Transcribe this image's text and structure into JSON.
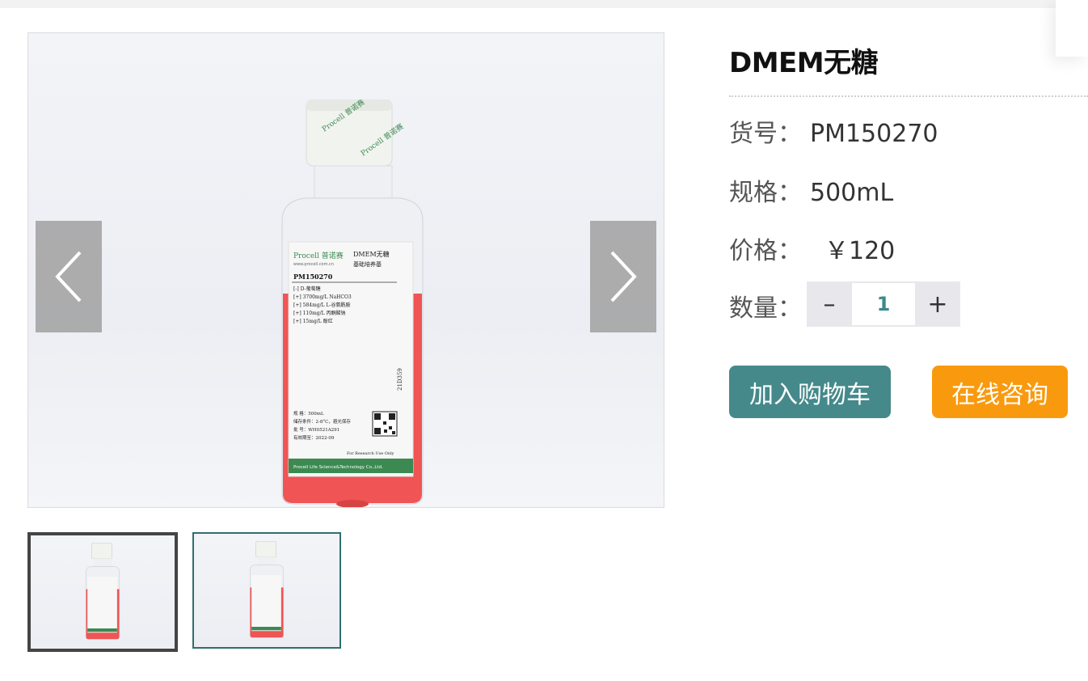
{
  "product": {
    "title": "DMEM无糖",
    "sku_label": "货号：",
    "sku_value": "PM150270",
    "spec_label": "规格：",
    "spec_value": "500mL",
    "price_label": "价格：",
    "price_value": "￥120",
    "qty_label": "数量：",
    "qty_value": "1",
    "minus_label": "–",
    "plus_label": "+"
  },
  "actions": {
    "add_to_cart": "加入购物车",
    "consult": "在线咨询"
  },
  "bottle_label": {
    "brand": "Procell 普诺赛",
    "website": "www.procell.com.cn",
    "product_name": "DMEM无糖",
    "product_sub": "基础培养基",
    "code": "PM150270",
    "ingredients": [
      "[-] D-葡萄糖",
      "[+] 3700mg/L NaHCO3",
      "[+] 584mg/L L-谷氨酰胺",
      "[+] 110mg/L 丙酮酸钠",
      "[+] 15mg/L 酚红"
    ],
    "spec_line": "规    格：500mL",
    "storage_line": "储存条件：2-8°C，避光保存",
    "lot_line": "批    号：WH0521A291",
    "expiry_line": "有效期至：2022-09",
    "side_code": "21D359",
    "research": "For Research Use Only",
    "footer": "Procell Life Science&Technology Co.,Ltd."
  },
  "colors": {
    "accent_teal": "#45898b",
    "accent_orange": "#f99a0e",
    "medium_red": "#f05454"
  },
  "icons": {
    "prev": "chevron-left-icon",
    "next": "chevron-right-icon"
  }
}
